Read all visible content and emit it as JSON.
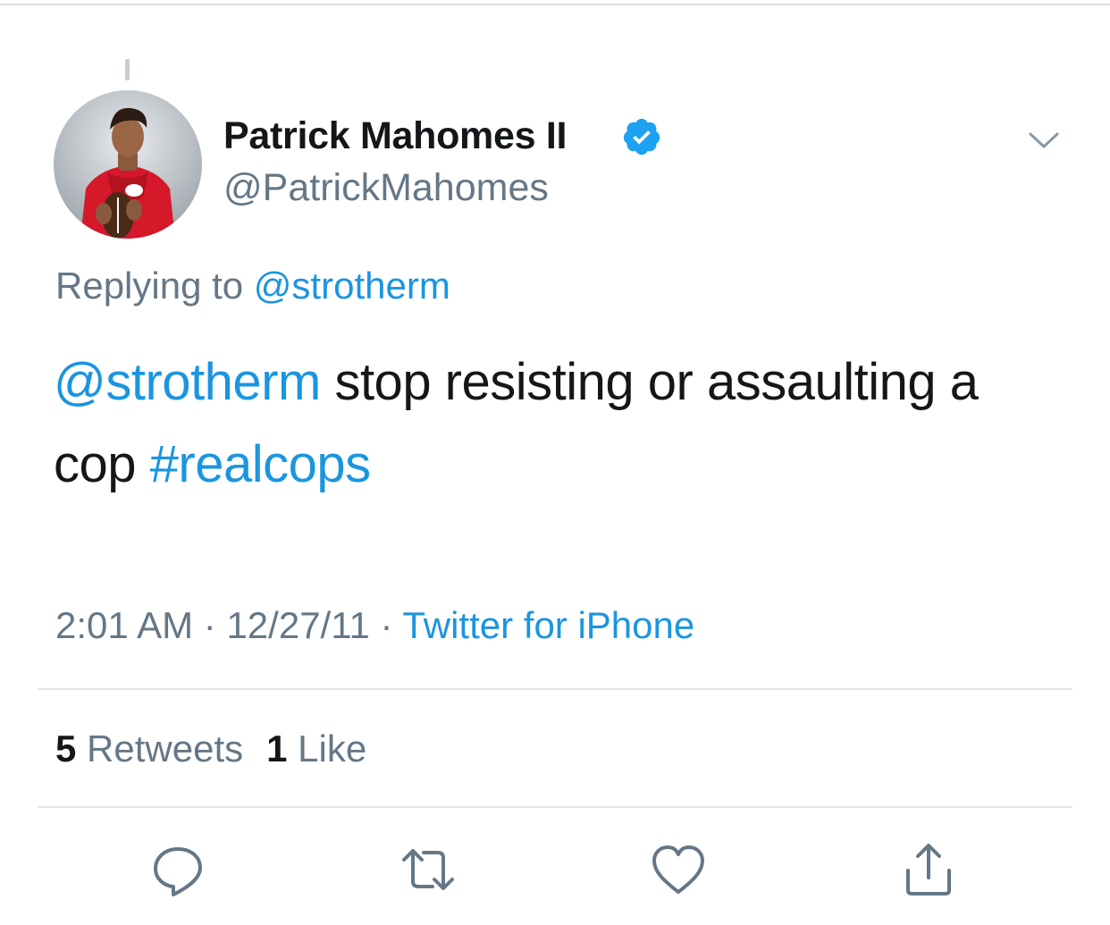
{
  "tweet": {
    "author": {
      "display_name": "Patrick Mahomes II",
      "handle": "@PatrickMahomes",
      "verified": true,
      "avatar_icon": "profile-photo"
    },
    "replying_to": {
      "prefix": "Replying to",
      "handle": "@strotherm"
    },
    "text": {
      "mention": "@strotherm",
      "body": " stop resisting or assaulting a cop ",
      "hashtag": "#realcops"
    },
    "meta": {
      "time": "2:01 AM",
      "separator": "·",
      "date": "12/27/11",
      "source": "Twitter for iPhone"
    },
    "stats": {
      "retweets_count": "5",
      "retweets_label": "Retweets",
      "likes_count": "1",
      "likes_label": "Like"
    },
    "actions": [
      {
        "name": "reply",
        "icon": "reply-icon"
      },
      {
        "name": "retweet",
        "icon": "retweet-icon"
      },
      {
        "name": "like",
        "icon": "heart-icon"
      },
      {
        "name": "share",
        "icon": "share-icon"
      }
    ]
  },
  "colors": {
    "link": "#1b95e0",
    "muted": "#657786",
    "text": "#14171a",
    "divider": "#e1e6ea"
  }
}
